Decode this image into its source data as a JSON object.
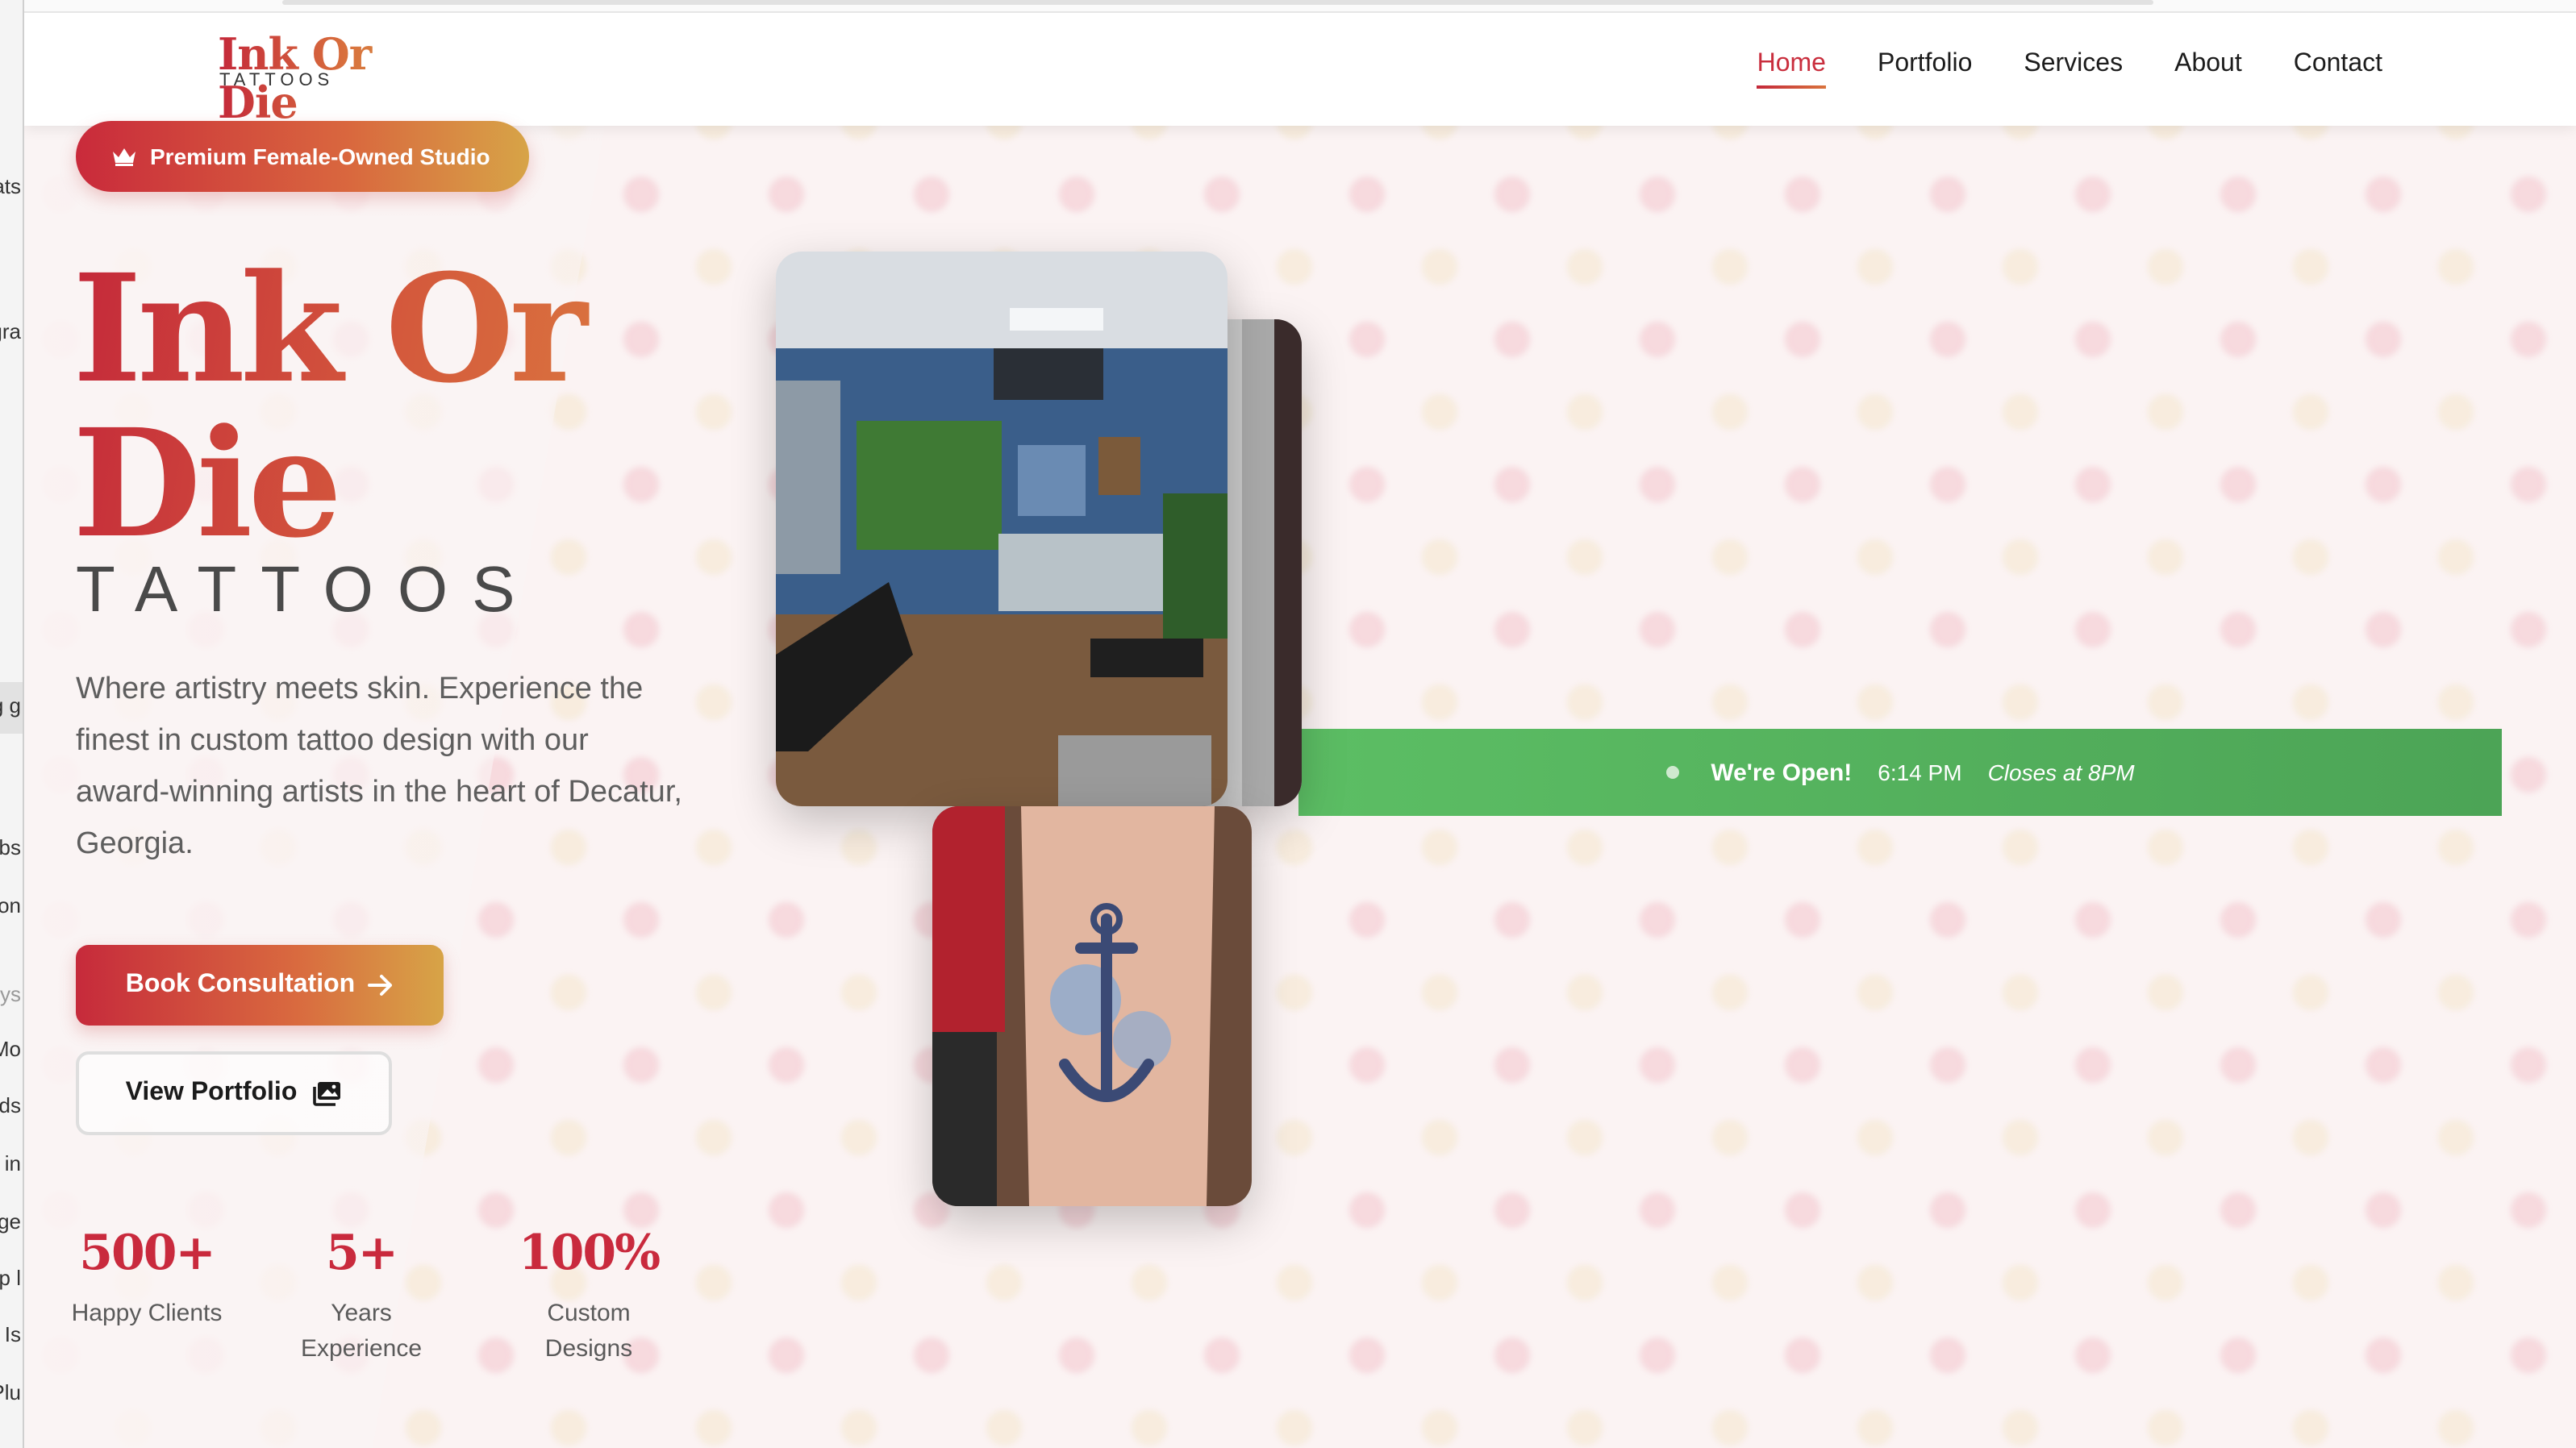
{
  "nav": {
    "logo_main": "Ink Or Die",
    "logo_sub": "TATTOOS",
    "links": [
      "Home",
      "Portfolio",
      "Services",
      "About",
      "Contact"
    ],
    "active": "Home"
  },
  "hero": {
    "badge": "Premium Female-Owned Studio",
    "title_line1": "Ink Or",
    "title_line2": "Die",
    "subtitle": "TATTOOS",
    "description": "Where artistry meets skin. Experience the finest in custom tattoo design with our award-winning artists in the heart of Decatur, Georgia.",
    "primary_button": "Book Consultation",
    "secondary_button": "View Portfolio"
  },
  "stats": [
    {
      "value": "500+",
      "label": "Happy Clients"
    },
    {
      "value": "5+",
      "label": "Years Experience"
    },
    {
      "value": "100%",
      "label": "Custom Designs"
    }
  ],
  "status": {
    "open_label": "We're Open!",
    "time": "6:14 PM",
    "closes": "Closes at 8PM"
  },
  "behind_window_fragments": [
    "ats",
    "gra",
    "g g",
    "ebs",
    "ron",
    "ys",
    "Mo",
    "ds",
    "s in",
    "ge",
    "p l",
    "l Is",
    "Plu"
  ],
  "colors": {
    "brand_red": "#c92a3d",
    "brand_orange": "#d96a3f",
    "brand_gold": "#d7a447",
    "open_green": "#58b860"
  },
  "icons": {
    "badge": "crown-icon",
    "primary_button": "arrow-right-icon",
    "secondary_button": "images-icon"
  }
}
